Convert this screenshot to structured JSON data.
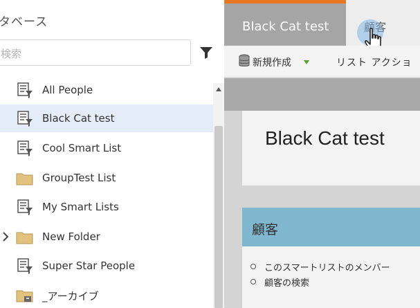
{
  "left_panel": {
    "title": "タベース",
    "search_placeholder": "検索",
    "tree_items": [
      {
        "label": "All People",
        "icon": "smart-list-icon"
      },
      {
        "label": "Black Cat test",
        "icon": "smart-list-icon",
        "selected": true
      },
      {
        "label": "Cool Smart List",
        "icon": "smart-list-icon"
      },
      {
        "label": "GroupTest List",
        "icon": "folder-icon"
      },
      {
        "label": "My Smart Lists",
        "icon": "smart-list-icon"
      },
      {
        "label": "New Folder",
        "icon": "folder-icon",
        "expandable": true
      },
      {
        "label": "Super Star People",
        "icon": "smart-list-icon"
      },
      {
        "label": "_アーカイブ",
        "icon": "archive-folder-icon"
      }
    ]
  },
  "tabs": [
    {
      "label": "Black Cat test",
      "active": true
    },
    {
      "label": "顧客",
      "active": false
    }
  ],
  "toolbar": {
    "new_label": "新規作成",
    "list_actions_label": "リスト アクショ"
  },
  "detail": {
    "title": "Black Cat test",
    "section_title": "顧客",
    "bullets": [
      "このスマートリストのメンバー",
      "顧客の検索"
    ]
  },
  "colors": {
    "accent_orange": "#e87722",
    "selected_row": "#e3ecf7",
    "section_header": "#7fb7cf",
    "active_tab": "#a5a5a5"
  }
}
